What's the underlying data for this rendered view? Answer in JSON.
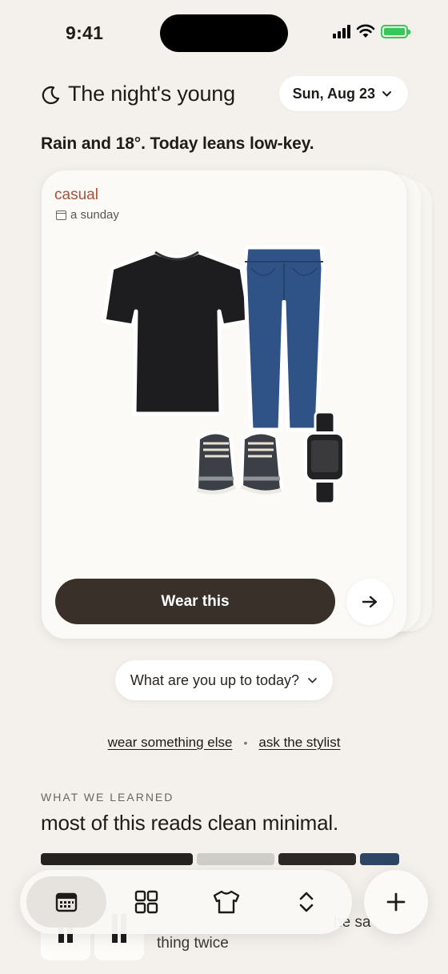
{
  "status_bar": {
    "time": "9:41"
  },
  "header": {
    "title": "The night's young",
    "date_label": "Sun, Aug 23"
  },
  "subtitle": "Rain and 18°. Today leans low-key.",
  "outfit_card": {
    "occasion": "casual",
    "day_label": "a sunday",
    "items": [
      "black-tshirt",
      "blue-jeans",
      "grey-sneakers",
      "black-watch"
    ],
    "wear_label": "Wear this"
  },
  "plans_select": {
    "label": "What are you up to today?"
  },
  "links": {
    "wear_else": "wear something else",
    "ask_stylist": "ask the stylist",
    "separator": "•"
  },
  "insights": {
    "section_label": "WHAT WE LEARNED",
    "heading": "most of this reads clean minimal.",
    "palette": [
      {
        "color": "#26221f",
        "share": 0.43
      },
      {
        "color": "#cfcdc8",
        "share": 0.22
      },
      {
        "color": "#2d2926",
        "share": 0.22
      },
      {
        "color": "#2e4565",
        "share": 0.11
      }
    ],
    "peek_text_1": "thing twice",
    "peek_text_2": "he sa"
  },
  "tab_bar": {
    "tabs": [
      "calendar-icon",
      "grid-icon",
      "tshirt-icon",
      "chevrons-updown-icon"
    ],
    "active_index": 0
  },
  "add_button": {
    "icon": "plus-icon"
  }
}
